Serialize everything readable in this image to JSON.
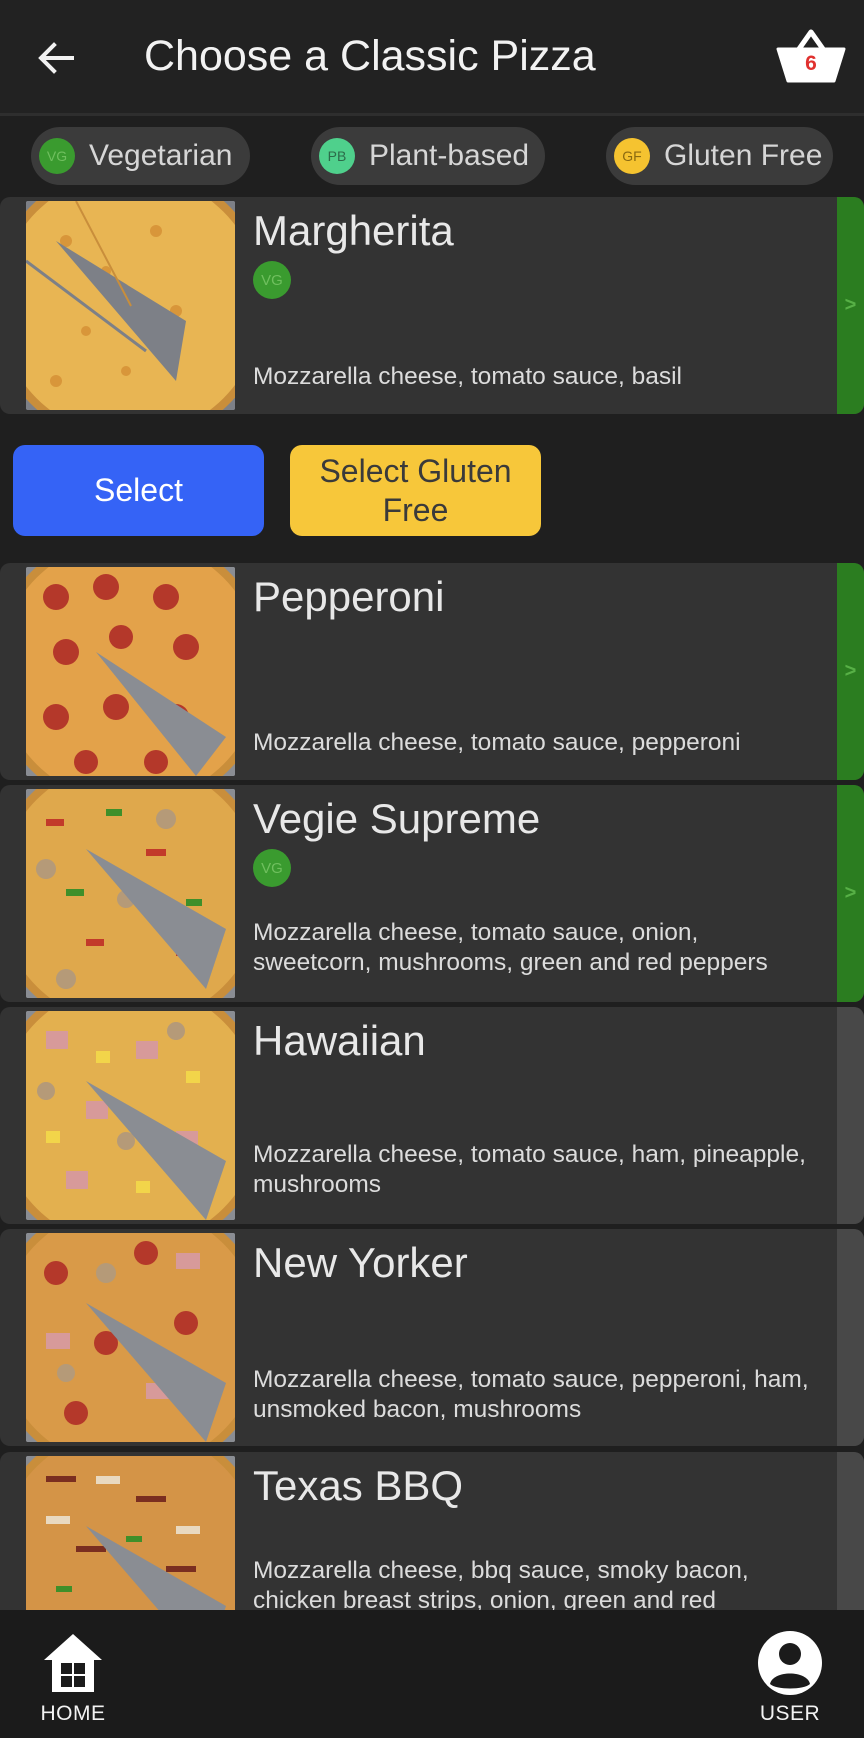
{
  "header": {
    "title": "Choose a Classic Pizza",
    "basket_count": "6",
    "back_icon": "arrow-left-icon",
    "basket_icon": "basket-icon"
  },
  "filters": [
    {
      "badge": "VG",
      "label": "Vegetarian",
      "badge_color": "#3a9b2f",
      "badge_text_color": "#6fbf5e"
    },
    {
      "badge": "PB",
      "label": "Plant-based",
      "badge_color": "#4fd08c",
      "badge_text_color": "#2c6b4a"
    },
    {
      "badge": "GF",
      "label": "Gluten Free",
      "badge_color": "#f5c330",
      "badge_text_color": "#8a6a10"
    }
  ],
  "pizzas": [
    {
      "name": "Margherita",
      "badge": "VG",
      "description": "Mozzarella cheese, tomato sauce, basil",
      "strip_icon": ">"
    },
    {
      "name": "Pepperoni",
      "badge": "",
      "description": "Mozzarella cheese, tomato sauce, pepperoni",
      "strip_icon": ">"
    },
    {
      "name": "Vegie Supreme",
      "badge": "VG",
      "description": "Mozzarella cheese, tomato sauce, onion, sweetcorn, mushrooms, green and red peppers",
      "strip_icon": ">"
    },
    {
      "name": "Hawaiian",
      "badge": "",
      "description": "Mozzarella cheese, tomato sauce, ham, pineapple, mushrooms"
    },
    {
      "name": "New Yorker",
      "badge": "",
      "description": "Mozzarella cheese, tomato sauce, pepperoni, ham, unsmoked bacon, mushrooms"
    },
    {
      "name": "Texas BBQ",
      "badge": "",
      "description": "Mozzarella cheese, bbq sauce, smoky bacon, chicken breast strips, onion, green and red"
    }
  ],
  "actions": {
    "select_label": "Select",
    "select_gluten_free_label": "Select Gluten Free"
  },
  "nav": {
    "home_label": "HOME",
    "user_label": "USER",
    "home_icon": "home-icon",
    "user_icon": "user-icon"
  },
  "colors": {
    "background": "#1f1f1f",
    "card": "#333333",
    "select_button": "#3563f6",
    "gluten_free_button": "#f7c73a",
    "selected_strip": "#2b7d20",
    "basket_count": "#e0312f"
  }
}
